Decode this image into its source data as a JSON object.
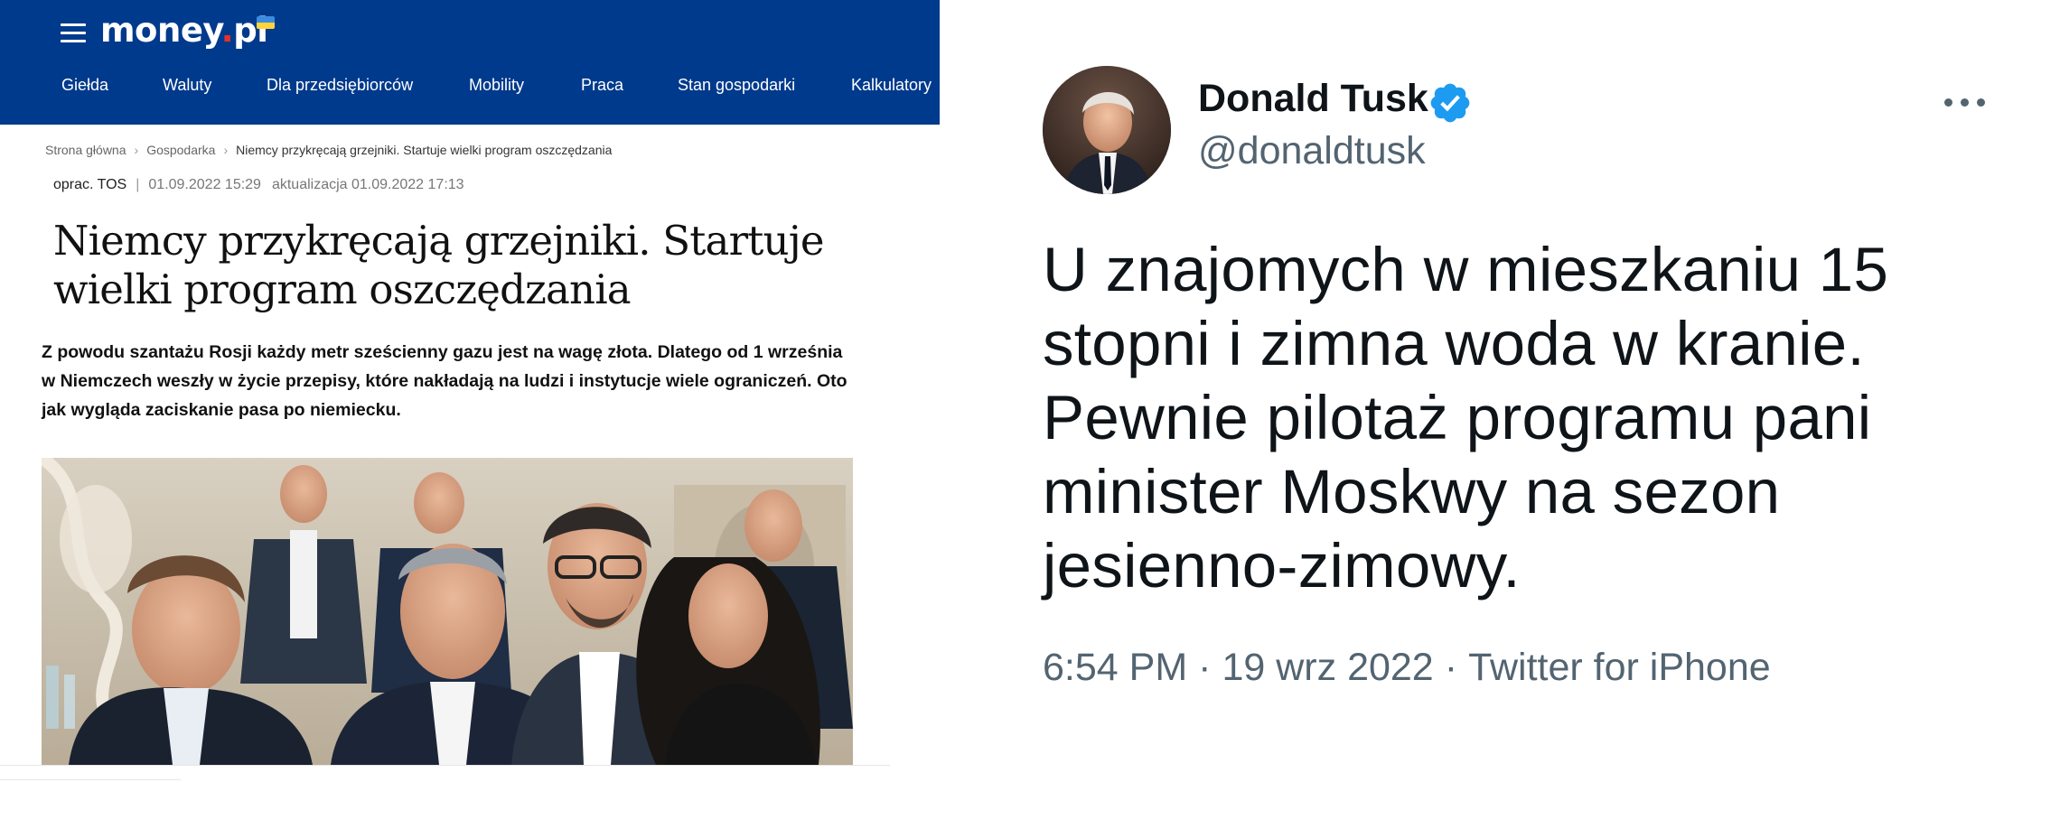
{
  "article": {
    "logo": {
      "text_main": "money",
      "text_dot": ".",
      "text_tld": "pl"
    },
    "nav": [
      "Giełda",
      "Waluty",
      "Dla przedsiębiorców",
      "Mobility",
      "Praca",
      "Stan gospodarki",
      "Kalkulatory"
    ],
    "breadcrumb": [
      "Strona główna",
      "Gospodarka",
      "Niemcy przykręcają grzejniki. Startuje wielki program oszczędzania"
    ],
    "meta": {
      "author": "oprac. TOS",
      "published": "01.09.2022 15:29",
      "updated": "aktualizacja 01.09.2022 17:13"
    },
    "headline": "Niemcy przykręcają grzejniki. Startuje wielki program oszczędzania",
    "lead": "Z powodu szantażu Rosji każdy metr sześcienny gazu jest na wagę złota. Dlatego od 1 września w Niemczech weszły w życie przepisy, które nakładają na ludzi i instytucje wiele ograniczeń. Oto jak wygląda zaciskanie pasa po niemiecku.",
    "colors": {
      "header_bg": "#003a8c",
      "logo_dot": "#e3312d"
    }
  },
  "tweet": {
    "name": "Donald Tusk",
    "handle": "@donaldtusk",
    "text": "U znajomych w mieszkaniu 15 stopni i zimna woda w kranie. Pewnie pilotaż programu pani minister Moskwy na sezon jesienno-zimowy.",
    "time": "6:54 PM",
    "date": "19 wrz 2022",
    "source": "Twitter for iPhone",
    "separator": "·",
    "colors": {
      "verified": "#1d9bf0",
      "text": "#0f1419",
      "muted": "#536471"
    }
  }
}
